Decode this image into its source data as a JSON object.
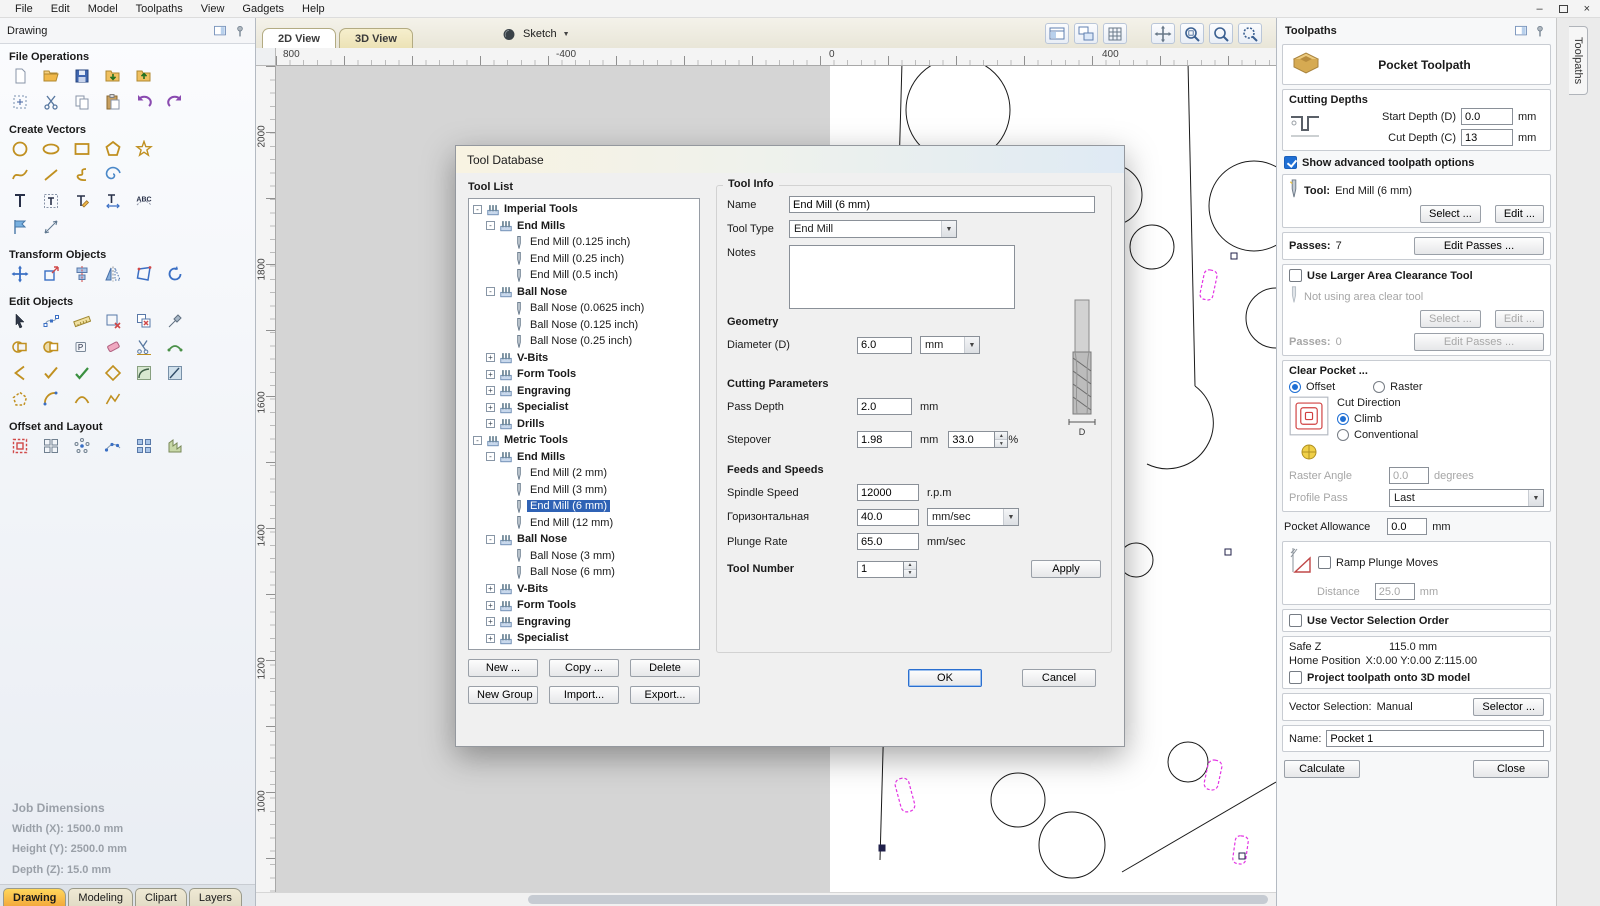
{
  "menubar": {
    "items": [
      "File",
      "Edit",
      "Model",
      "Toolpaths",
      "View",
      "Gadgets",
      "Help"
    ]
  },
  "left_panel": {
    "title": "Drawing",
    "sections": [
      {
        "label": "File Operations",
        "rows": [
          [
            "new-file-icon",
            "open-file-icon",
            "save-file-icon",
            "import-vectors-icon",
            "export-vectors-icon"
          ],
          [
            "select-all-icon",
            "cut-icon",
            "copy-icon",
            "paste-icon",
            "undo-icon",
            "redo-icon"
          ]
        ]
      },
      {
        "label": "Create Vectors",
        "rows": [
          [
            "draw-circle-icon",
            "draw-ellipse-icon",
            "draw-rectangle-icon",
            "draw-polygon-icon",
            "draw-star-icon"
          ],
          [
            "draw-curve-icon",
            "draw-line-icon",
            "draw-bezier-icon",
            "draw-spiral-icon"
          ],
          [
            "draw-text-icon",
            "text-box-icon",
            "edit-text-icon",
            "text-spacing-icon",
            "text-on-curve-icon"
          ],
          [
            "trace-bitmap-icon",
            "dimension-icon"
          ]
        ]
      },
      {
        "label": "Transform Objects",
        "rows": [
          [
            "move-icon",
            "set-size-icon",
            "align-icon",
            "mirror-icon",
            "distort-icon",
            "rotate-icon"
          ]
        ]
      },
      {
        "label": "Edit Objects",
        "rows": [
          [
            "select-icon",
            "node-edit-icon",
            "measure-icon",
            "vector-validator-icon",
            "remove-duplicates-icon",
            "pick-icon"
          ],
          [
            "weld-icon",
            "subtract-icon",
            "keep-overlap-icon",
            "erase-icon",
            "trim-icon",
            "smooth-icon"
          ],
          [
            "angle-icon",
            "snap-check-icon",
            "join-icon",
            "close-vector-icon",
            "fillet-icon",
            "chamfer-icon"
          ],
          [
            "stitch-icon",
            "arc-fit-icon",
            "curve-fit-icon",
            "polyline-fit-icon"
          ]
        ]
      },
      {
        "label": "Offset and Layout",
        "rows": [
          [
            "offset-icon",
            "layout-icon",
            "circular-copy-icon",
            "copy-along-icon",
            "array-copy-icon",
            "nest-icon"
          ]
        ]
      }
    ],
    "job_dimensions": {
      "title": "Job Dimensions",
      "width": "Width  (X): 1500.0 mm",
      "height": "Height (Y): 2500.0 mm",
      "depth": "Depth  (Z): 15.0 mm"
    },
    "tabs": [
      "Drawing",
      "Modeling",
      "Clipart",
      "Layers"
    ],
    "active_tab": "Drawing"
  },
  "view_area": {
    "tabs": [
      "2D View",
      "3D View"
    ],
    "active_tab": "2D View",
    "sketch_label": "Sketch",
    "toolbar_icons": [
      "window-layout-icon",
      "multi-window-icon",
      "grid-icon",
      "pan-icon",
      "zoom-window-icon",
      "zoom-drawing-icon",
      "zoom-selection-icon"
    ],
    "ruler_h": [
      "800",
      "-400",
      "0",
      "400"
    ],
    "ruler_v": [
      "2000",
      "1800",
      "1600",
      "1400",
      "1200",
      "1000"
    ]
  },
  "dialog": {
    "title": "Tool Database",
    "tool_list_label": "Tool List",
    "tree": [
      {
        "label": "Imperial Tools",
        "level": 0,
        "type": "group",
        "expanded": true
      },
      {
        "label": "End Mills",
        "level": 1,
        "type": "group",
        "expanded": true
      },
      {
        "label": "End Mill (0.125 inch)",
        "level": 2,
        "type": "tool"
      },
      {
        "label": "End Mill (0.25 inch)",
        "level": 2,
        "type": "tool"
      },
      {
        "label": "End Mill (0.5 inch)",
        "level": 2,
        "type": "tool"
      },
      {
        "label": "Ball Nose",
        "level": 1,
        "type": "group",
        "expanded": true
      },
      {
        "label": "Ball Nose (0.0625 inch)",
        "level": 2,
        "type": "tool"
      },
      {
        "label": "Ball Nose (0.125 inch)",
        "level": 2,
        "type": "tool"
      },
      {
        "label": "Ball Nose (0.25 inch)",
        "level": 2,
        "type": "tool"
      },
      {
        "label": "V-Bits",
        "level": 1,
        "type": "group",
        "expanded": false
      },
      {
        "label": "Form Tools",
        "level": 1,
        "type": "group",
        "expanded": false
      },
      {
        "label": "Engraving",
        "level": 1,
        "type": "group",
        "expanded": false
      },
      {
        "label": "Specialist",
        "level": 1,
        "type": "group",
        "expanded": false
      },
      {
        "label": "Drills",
        "level": 1,
        "type": "group",
        "expanded": false
      },
      {
        "label": "Metric Tools",
        "level": 0,
        "type": "group",
        "expanded": true
      },
      {
        "label": "End Mills",
        "level": 1,
        "type": "group",
        "expanded": true
      },
      {
        "label": "End Mill (2 mm)",
        "level": 2,
        "type": "tool"
      },
      {
        "label": "End Mill (3 mm)",
        "level": 2,
        "type": "tool"
      },
      {
        "label": "End Mill (6 mm)",
        "level": 2,
        "type": "tool",
        "selected": true
      },
      {
        "label": "End Mill (12 mm)",
        "level": 2,
        "type": "tool"
      },
      {
        "label": "Ball Nose",
        "level": 1,
        "type": "group",
        "expanded": true
      },
      {
        "label": "Ball Nose (3 mm)",
        "level": 2,
        "type": "tool"
      },
      {
        "label": "Ball Nose (6 mm)",
        "level": 2,
        "type": "tool"
      },
      {
        "label": "V-Bits",
        "level": 1,
        "type": "group",
        "expanded": false
      },
      {
        "label": "Form Tools",
        "level": 1,
        "type": "group",
        "expanded": false
      },
      {
        "label": "Engraving",
        "level": 1,
        "type": "group",
        "expanded": false
      },
      {
        "label": "Specialist",
        "level": 1,
        "type": "group",
        "expanded": false
      }
    ],
    "buttons": {
      "new": "New ...",
      "copy": "Copy ...",
      "delete": "Delete",
      "new_group": "New Group",
      "import": "Import...",
      "export": "Export..."
    },
    "tool_info": {
      "label": "Tool Info",
      "name_label": "Name",
      "name_value": "End Mill (6 mm)",
      "tool_type_label": "Tool Type",
      "tool_type_value": "End Mill",
      "notes_label": "Notes",
      "geometry_label": "Geometry",
      "diameter_label": "Diameter (D)",
      "diameter_value": "6.0",
      "diameter_units": "mm",
      "cutting_label": "Cutting Parameters",
      "pass_depth_label": "Pass Depth",
      "pass_depth_value": "2.0",
      "pass_depth_units": "mm",
      "stepover_label": "Stepover",
      "stepover_value": "1.98",
      "stepover_units": "mm",
      "stepover_pct_value": "33.0",
      "stepover_pct_units": "%",
      "feeds_label": "Feeds and Speeds",
      "spindle_label": "Spindle Speed",
      "spindle_value": "12000",
      "spindle_units": "r.p.m",
      "feed_label": "Горизонтальная",
      "feed_value": "40.0",
      "feed_units": "mm/sec",
      "plunge_label": "Plunge Rate",
      "plunge_value": "65.0",
      "plunge_units": "mm/sec",
      "tool_number_label": "Tool Number",
      "tool_number_value": "1",
      "apply": "Apply"
    },
    "ok": "OK",
    "cancel": "Cancel"
  },
  "toolpaths": {
    "panel_title": "Toolpaths",
    "vertical_tab": "Toolpaths",
    "header": {
      "title": "Pocket Toolpath"
    },
    "cutting_depths": {
      "title": "Cutting Depths",
      "start_depth_label": "Start Depth (D)",
      "start_depth_value": "0.0",
      "start_depth_units": "mm",
      "cut_depth_label": "Cut Depth (C)",
      "cut_depth_value": "13",
      "cut_depth_units": "mm"
    },
    "show_advanced": "Show advanced toolpath options",
    "tool": {
      "label": "Tool:",
      "value": "End Mill (6 mm)",
      "select": "Select ...",
      "edit": "Edit ...",
      "passes_label": "Passes:",
      "passes_value": "7",
      "edit_passes": "Edit Passes ..."
    },
    "area_clearance": {
      "checkbox": "Use Larger Area Clearance Tool",
      "status": "Not using area clear tool",
      "select": "Select ...",
      "edit": "Edit ...",
      "passes_label": "Passes:",
      "passes_value": "0",
      "edit_passes": "Edit Passes ..."
    },
    "clear_pocket": {
      "title": "Clear Pocket ...",
      "offset": "Offset",
      "raster": "Raster",
      "cut_direction": "Cut Direction",
      "climb": "Climb",
      "conventional": "Conventional",
      "raster_angle_label": "Raster Angle",
      "raster_angle_value": "0.0",
      "raster_angle_units": "degrees",
      "profile_pass_label": "Profile Pass",
      "profile_pass_value": "Last"
    },
    "pocket_allowance": {
      "label": "Pocket Allowance",
      "value": "0.0",
      "units": "mm"
    },
    "ramp": {
      "checkbox": "Ramp Plunge Moves",
      "distance_label": "Distance",
      "distance_value": "25.0",
      "distance_units": "mm"
    },
    "vector_order": "Use Vector Selection Order",
    "safe_z": {
      "label": "Safe Z",
      "value": "115.0 mm"
    },
    "home_position": {
      "label": "Home Position",
      "value": "X:0.00 Y:0.00 Z:115.00"
    },
    "project_3d": "Project toolpath onto 3D model",
    "vector_selection": {
      "label": "Vector Selection:",
      "value": "Manual",
      "selector": "Selector ..."
    },
    "name": {
      "label": "Name:",
      "value": "Pocket 1"
    },
    "calculate": "Calculate",
    "close": "Close"
  }
}
